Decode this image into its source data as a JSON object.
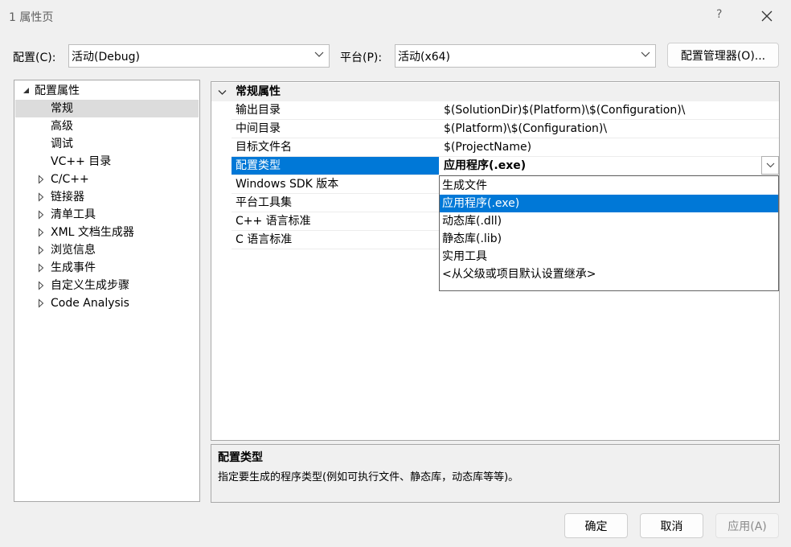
{
  "window": {
    "title": "1 属性页",
    "help": "?"
  },
  "toolbar": {
    "config_label": "配置(C):",
    "config_value": "活动(Debug)",
    "platform_label": "平台(P):",
    "platform_value": "活动(x64)",
    "manager_button": "配置管理器(O)..."
  },
  "tree": {
    "items": [
      {
        "label": "配置属性",
        "level": 0,
        "expander": "expanded"
      },
      {
        "label": "常规",
        "level": 1,
        "expander": "none",
        "selected": true
      },
      {
        "label": "高级",
        "level": 1,
        "expander": "none"
      },
      {
        "label": "调试",
        "level": 1,
        "expander": "none"
      },
      {
        "label": "VC++ 目录",
        "level": 1,
        "expander": "none"
      },
      {
        "label": "C/C++",
        "level": 1,
        "expander": "collapsed"
      },
      {
        "label": "链接器",
        "level": 1,
        "expander": "collapsed"
      },
      {
        "label": "清单工具",
        "level": 1,
        "expander": "collapsed"
      },
      {
        "label": "XML 文档生成器",
        "level": 1,
        "expander": "collapsed"
      },
      {
        "label": "浏览信息",
        "level": 1,
        "expander": "collapsed"
      },
      {
        "label": "生成事件",
        "level": 1,
        "expander": "collapsed"
      },
      {
        "label": "自定义生成步骤",
        "level": 1,
        "expander": "collapsed"
      },
      {
        "label": "Code Analysis",
        "level": 1,
        "expander": "collapsed"
      }
    ]
  },
  "grid": {
    "category": "常规属性",
    "rows": [
      {
        "name": "输出目录",
        "value": "$(SolutionDir)$(Platform)\\$(Configuration)\\"
      },
      {
        "name": "中间目录",
        "value": "$(Platform)\\$(Configuration)\\"
      },
      {
        "name": "目标文件名",
        "value": "$(ProjectName)"
      },
      {
        "name": "配置类型",
        "value": "应用程序(.exe)",
        "selected": true
      },
      {
        "name": "Windows SDK 版本",
        "value": ""
      },
      {
        "name": "平台工具集",
        "value": ""
      },
      {
        "name": "C++ 语言标准",
        "value": ""
      },
      {
        "name": "C 语言标准",
        "value": ""
      }
    ]
  },
  "dropdown": {
    "options": [
      "生成文件",
      "应用程序(.exe)",
      "动态库(.dll)",
      "静态库(.lib)",
      "实用工具",
      "<从父级或项目默认设置继承>"
    ],
    "selected_index": 1
  },
  "description": {
    "title": "配置类型",
    "text": "指定要生成的程序类型(例如可执行文件、静态库，动态库等等)。"
  },
  "buttons": {
    "ok": "确定",
    "cancel": "取消",
    "apply": "应用(A)"
  },
  "colors": {
    "selection": "#0078d7",
    "tree_selection": "#dcdcdc",
    "window_bg": "#f0f0f0"
  }
}
